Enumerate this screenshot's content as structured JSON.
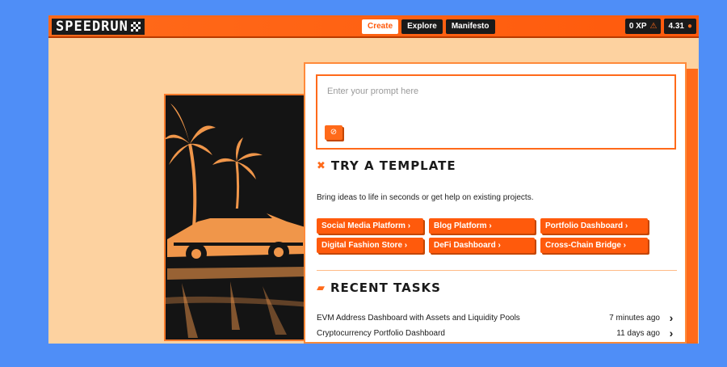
{
  "app": {
    "logo_text": "SPEEDRUN",
    "nav": [
      {
        "label": "Create",
        "active": true
      },
      {
        "label": "Explore",
        "active": false
      },
      {
        "label": "Manifesto",
        "active": false
      }
    ],
    "stats": [
      {
        "value": "0 XP",
        "icon": "warning-triangle-icon"
      },
      {
        "value": "4.31",
        "icon": "coin-icon"
      }
    ]
  },
  "prompt": {
    "placeholder": "Enter your prompt here",
    "value": "",
    "attach_icon": "attach-icon"
  },
  "templates_section": {
    "title": "TRY A TEMPLATE",
    "icon": "tools-icon",
    "subtitle": "Bring ideas to life in seconds or get help on existing projects.",
    "items": [
      {
        "label": "Social Media Platform ›"
      },
      {
        "label": "Blog Platform ›"
      },
      {
        "label": "Portfolio Dashboard ›"
      },
      {
        "label": "Digital Fashion Store ›"
      },
      {
        "label": "DeFi Dashboard ›"
      },
      {
        "label": "Cross-Chain Bridge ›"
      }
    ]
  },
  "recent_section": {
    "title": "RECENT TASKS",
    "icon": "folder-icon",
    "items": [
      {
        "name": "EVM Address Dashboard with Assets and Liquidity Pools",
        "time": "7 minutes ago"
      },
      {
        "name": "Cryptocurrency Portfolio Dashboard",
        "time": "11 days ago"
      }
    ]
  },
  "colors": {
    "accent": "#ff5a0c",
    "background_outer": "#4f8ef7",
    "background_page": "#fdd2a0",
    "dark": "#1a1a1a"
  }
}
